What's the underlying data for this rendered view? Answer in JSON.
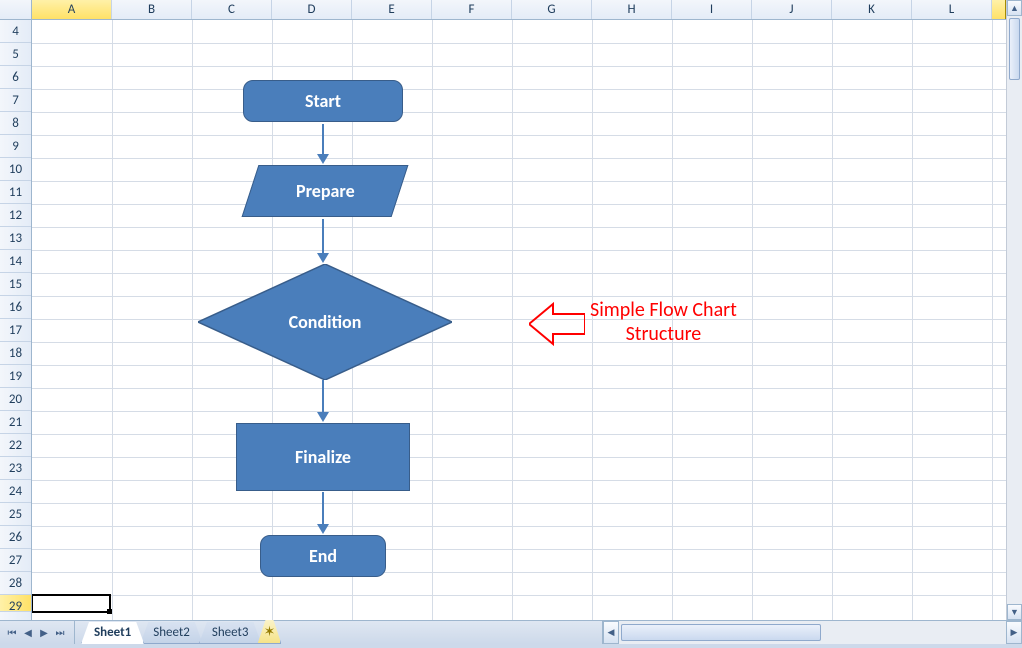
{
  "columns": [
    "A",
    "B",
    "C",
    "D",
    "E",
    "F",
    "G",
    "H",
    "I",
    "J",
    "K",
    "L"
  ],
  "rows_start": 4,
  "rows_end": 29,
  "selected_row": 29,
  "selected_col": "A",
  "flowchart": {
    "start": "Start",
    "prepare": "Prepare",
    "condition": "Condition",
    "finalize": "Finalize",
    "end": "End"
  },
  "annotation": {
    "line1": "Simple Flow Chart",
    "line2": "Structure"
  },
  "tabs": {
    "sheet1": "Sheet1",
    "sheet2": "Sheet2",
    "sheet3": "Sheet3"
  }
}
